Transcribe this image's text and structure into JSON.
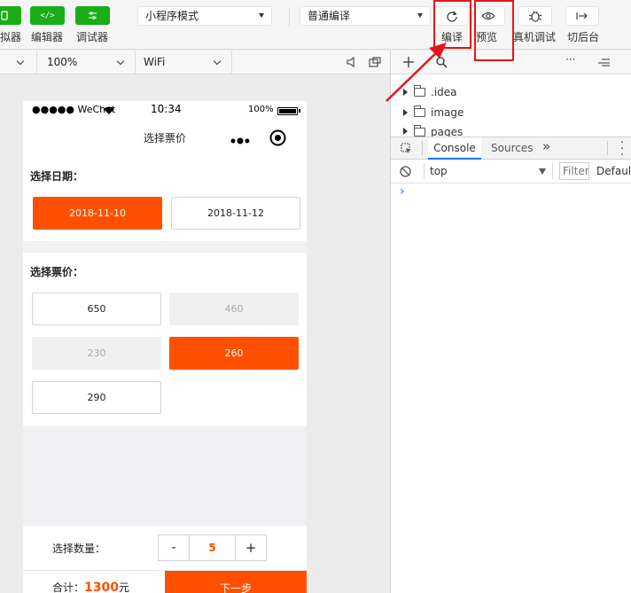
{
  "toolbar": {
    "left_buttons": [
      {
        "label": "拟器",
        "icon": "phone-icon"
      },
      {
        "label": "编辑器",
        "icon": "code-icon"
      },
      {
        "label": "调试器",
        "icon": "debug-settings-icon"
      }
    ],
    "mode_select": "小程序模式",
    "compile_select": "普通编译",
    "right_buttons": [
      {
        "label": "编译",
        "icon": "refresh-icon"
      },
      {
        "label": "预览",
        "icon": "eye-icon"
      },
      {
        "label": "真机调试",
        "icon": "bug-icon"
      },
      {
        "label": "切后台",
        "icon": "switch-background-icon"
      }
    ]
  },
  "subbar": {
    "zoom": "100%",
    "network": "WiFi"
  },
  "simulator": {
    "status": {
      "carrier": "●●●●● WeChat",
      "time": "10:34",
      "battery": "100%"
    },
    "nav_title": "选择票价",
    "date_section": {
      "title": "选择日期：",
      "dates": [
        {
          "label": "2018-11-10",
          "state": "selected"
        },
        {
          "label": "2018-11-12",
          "state": "normal"
        }
      ]
    },
    "price_section": {
      "title": "选择票价：",
      "prices": [
        {
          "label": "650",
          "state": "normal"
        },
        {
          "label": "460",
          "state": "disabled"
        },
        {
          "label": "230",
          "state": "disabled"
        },
        {
          "label": "260",
          "state": "selected"
        },
        {
          "label": "290",
          "state": "normal"
        }
      ]
    },
    "quantity": {
      "label": "选择数量：",
      "minus": "-",
      "value": "5",
      "plus": "+"
    },
    "total": {
      "prefix": "合计：",
      "amount": "1300",
      "unit": "元"
    },
    "next_button": "下一步"
  },
  "devtools": {
    "tree": [
      ".idea",
      "image",
      "pages"
    ],
    "tabs": [
      "Console",
      "Sources"
    ],
    "more_tabs": "»",
    "context": "top",
    "filter_placeholder": "Filter",
    "levels": "Default",
    "prompt": "›"
  },
  "colors": {
    "accent": "#ff5000",
    "wechat_green": "#1aad19",
    "annotation_red": "#e8141b"
  }
}
